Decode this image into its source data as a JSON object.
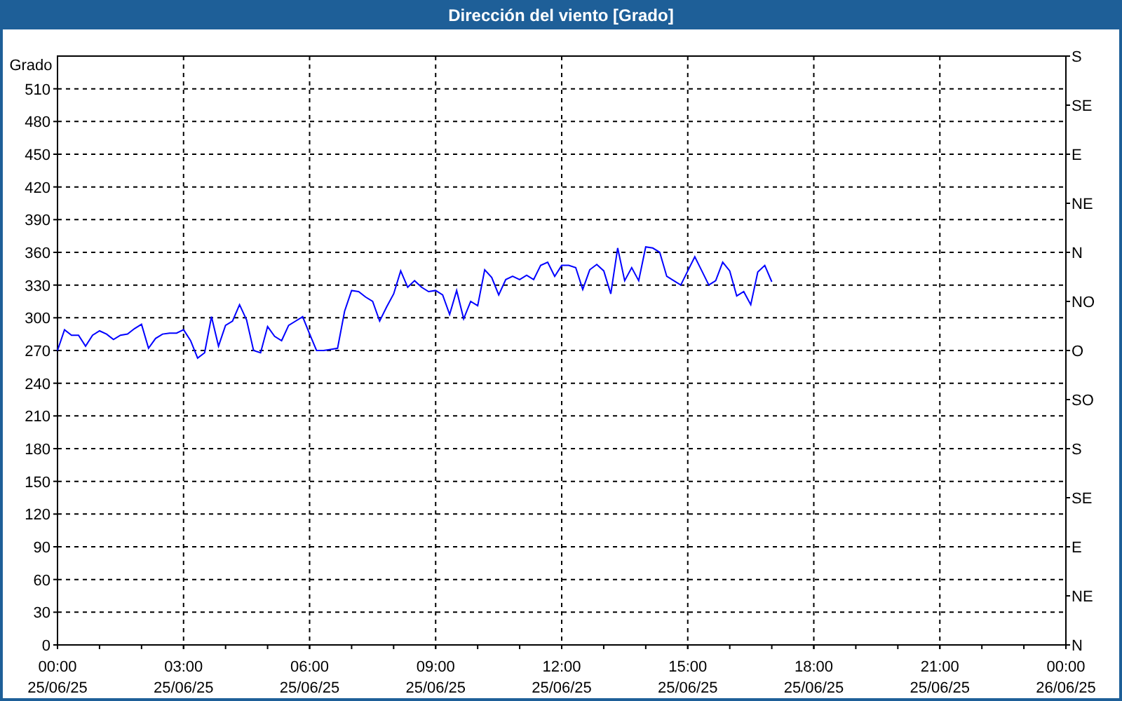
{
  "chart_data": {
    "type": "line",
    "title": "Dirección del viento [Grado]",
    "ylabel": "Grado",
    "ylim": [
      0,
      540
    ],
    "grid": true,
    "yticks": [
      0,
      30,
      60,
      90,
      120,
      150,
      180,
      210,
      240,
      270,
      300,
      330,
      360,
      390,
      420,
      450,
      480,
      510
    ],
    "categories": [
      "00:00 25/06/25",
      null,
      null,
      null,
      null,
      null,
      null,
      null,
      null,
      null,
      null,
      null,
      null,
      null,
      null,
      null,
      null,
      null,
      "03:00 25/06/25",
      null,
      null,
      null,
      null,
      null,
      null,
      null,
      null,
      null,
      null,
      null,
      null,
      null,
      null,
      null,
      null,
      null,
      "06:00 25/06/25",
      null,
      null,
      null,
      null,
      null,
      null,
      null,
      null,
      null,
      null,
      null,
      null,
      null,
      null,
      null,
      null,
      null,
      "09:00 25/06/25",
      null,
      null,
      null,
      null,
      null,
      null,
      null,
      null,
      null,
      null,
      null,
      null,
      null,
      null,
      null,
      null,
      null,
      "12:00 25/06/25",
      null,
      null,
      null,
      null,
      null,
      null,
      null,
      null,
      null,
      null,
      null,
      null,
      null,
      null,
      null,
      null,
      null,
      "15:00 25/06/25",
      null,
      null,
      null,
      null,
      null,
      null,
      null,
      null,
      null,
      null,
      null,
      null,
      null,
      null,
      null,
      null,
      null,
      "18:00 25/06/25",
      null,
      null,
      null,
      null,
      null,
      null,
      null,
      null,
      null,
      null,
      null,
      null,
      null,
      null,
      null,
      null,
      null,
      "21:00 25/06/25",
      null,
      null,
      null,
      null,
      null,
      null,
      null,
      null,
      null,
      null,
      null,
      null,
      null,
      null,
      null,
      null,
      null,
      "00:00 26/06/25"
    ],
    "series": [
      {
        "color": "#0000ff",
        "values": [
          270,
          289,
          284,
          284,
          274,
          284,
          288,
          285,
          280,
          284,
          285,
          290,
          294,
          272,
          281,
          285,
          286,
          286,
          289,
          279,
          263,
          268,
          301,
          274,
          293,
          297,
          312,
          298,
          270,
          268,
          292,
          283,
          279,
          293,
          297,
          301,
          285,
          270,
          270,
          271,
          272,
          306,
          325,
          324,
          319,
          315,
          297,
          310,
          322,
          343,
          328,
          334,
          328,
          324,
          325,
          321,
          303,
          325,
          299,
          315,
          311,
          344,
          337,
          321,
          335,
          338,
          335,
          339,
          335,
          348,
          351,
          338,
          348,
          348,
          346,
          326,
          344,
          349,
          343,
          322,
          364,
          334,
          346,
          334,
          365,
          364,
          360,
          338,
          334,
          330,
          343,
          356,
          343,
          330,
          334,
          351,
          343,
          320,
          324,
          312,
          342,
          348,
          333,
          null,
          null,
          null,
          null,
          null,
          null,
          null,
          null,
          null,
          null,
          null,
          null,
          null,
          null,
          null,
          null,
          null,
          null,
          null,
          null,
          null,
          null,
          null,
          null,
          null,
          null,
          null,
          null,
          null,
          null,
          null,
          null,
          null,
          null,
          null,
          null,
          null,
          null,
          null,
          null,
          null,
          null
        ]
      }
    ]
  },
  "compass_labels": [
    "S",
    "SE",
    "E",
    "NE",
    "N",
    "NO",
    "O",
    "SO",
    "S",
    "SE",
    "E",
    "NE",
    "N"
  ]
}
